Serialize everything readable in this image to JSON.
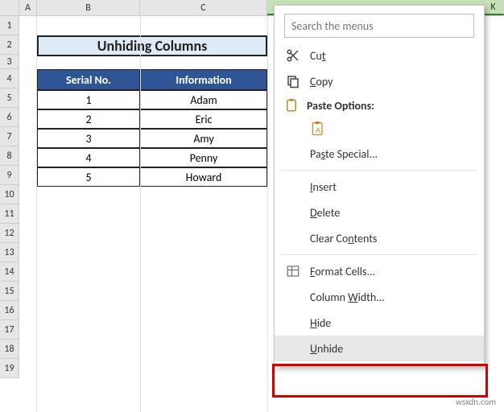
{
  "columns": {
    "corner": "",
    "A": "A",
    "B": "B",
    "C": "C",
    "K": "K"
  },
  "rows": [
    "1",
    "2",
    "3",
    "4",
    "5",
    "6",
    "7",
    "8",
    "9",
    "10",
    "11",
    "12",
    "13",
    "14",
    "15",
    "16",
    "17",
    "18",
    "19"
  ],
  "title": "Unhiding Columns",
  "table": {
    "headers": {
      "serial": "Serial No.",
      "info": "Information"
    },
    "rows": [
      {
        "serial": "1",
        "info": "Adam"
      },
      {
        "serial": "2",
        "info": "Eric"
      },
      {
        "serial": "3",
        "info": "Amy"
      },
      {
        "serial": "4",
        "info": "Penny"
      },
      {
        "serial": "5",
        "info": "Howard"
      }
    ]
  },
  "menu": {
    "search_placeholder": "Search the menus",
    "cut": "Cut",
    "copy": "Copy",
    "paste_options": "Paste Options:",
    "paste_special": "Paste Special...",
    "insert": "Insert",
    "delete": "Delete",
    "clear_contents": "Clear Contents",
    "format_cells": "Format Cells...",
    "column_width": "Column Width...",
    "hide": "Hide",
    "unhide": "Unhide"
  },
  "watermark": "wsxdn.com"
}
